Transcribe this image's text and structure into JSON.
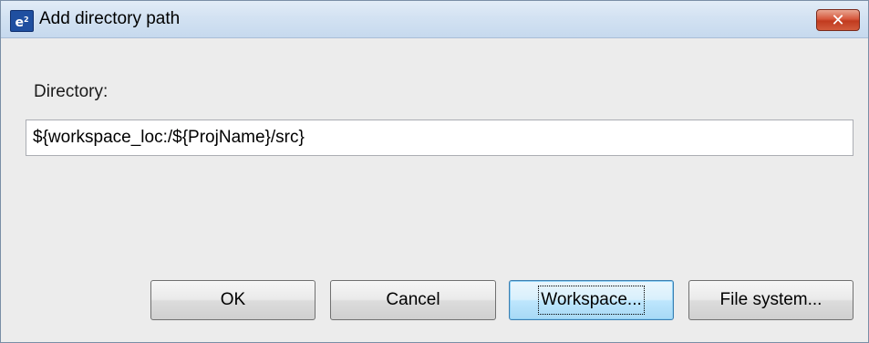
{
  "window": {
    "title": "Add directory path",
    "icon": "eclipse-e2-icon",
    "close_label": "✕"
  },
  "form": {
    "directory_label": "Directory:",
    "directory_value": "${workspace_loc:/${ProjName}/src}"
  },
  "buttons": {
    "ok": "OK",
    "cancel": "Cancel",
    "workspace": "Workspace...",
    "file_system": "File system..."
  },
  "colors": {
    "titlebar": "#d3e2f2",
    "close_button": "#c13b1f",
    "focused_button": "#bee6fd",
    "dialog_background": "#ececec"
  }
}
